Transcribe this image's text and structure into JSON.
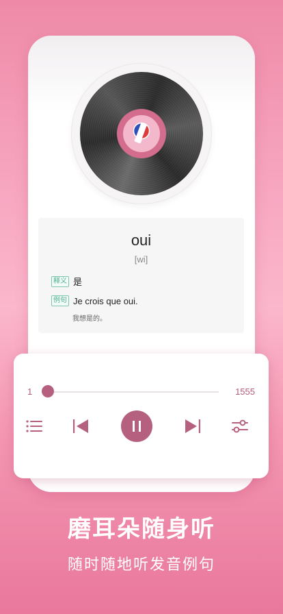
{
  "card": {
    "word": "oui",
    "phonetic": "[wi]",
    "meaning_tag": "释义",
    "meaning": "是",
    "example_tag": "例句",
    "example": "Je crois que oui.",
    "example_translation": "我想是的。"
  },
  "player": {
    "position_start": "1",
    "position_total": "1555",
    "progress_fraction": 0.0
  },
  "icons": {
    "playlist": "list-icon",
    "previous": "skip-previous-icon",
    "play_pause": "pause-icon",
    "next": "skip-next-icon",
    "settings": "sliders-icon",
    "record": "vinyl-record",
    "flag": "france-flag-bulb-icon"
  },
  "colors": {
    "accent": "#b5607e",
    "tag_green": "#4fae8f",
    "background_pink": "#f7a6c0"
  },
  "promo": {
    "headline": "磨耳朵随身听",
    "subline": "随时随地听发音例句"
  }
}
